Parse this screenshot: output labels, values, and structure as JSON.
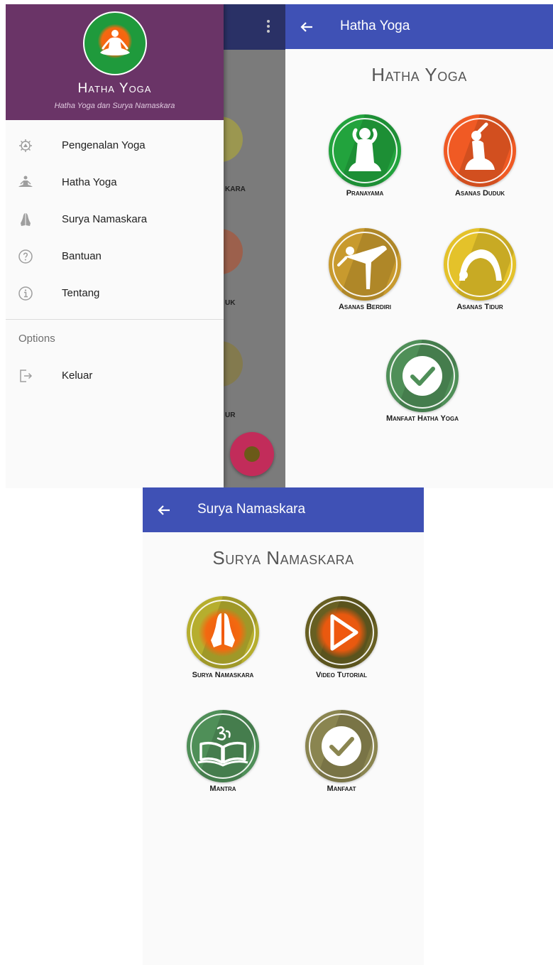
{
  "drawer_screen": {
    "background_labels": [
      "KARA",
      "UK",
      "UR"
    ],
    "header": {
      "title": "Hatha Yoga",
      "subtitle": "Hatha Yoga dan Surya Namaskara"
    },
    "menu": [
      {
        "label": "Pengenalan Yoga",
        "icon": "chakra-icon"
      },
      {
        "label": "Hatha Yoga",
        "icon": "meditation-pose-icon"
      },
      {
        "label": "Surya Namaskara",
        "icon": "praying-hands-icon"
      },
      {
        "label": "Bantuan",
        "icon": "help-icon"
      },
      {
        "label": "Tentang",
        "icon": "info-icon"
      }
    ],
    "section_label": "Options",
    "logout_label": "Keluar"
  },
  "hatha_screen": {
    "appbar_title": "Hatha Yoga",
    "heading": "Hatha Yoga",
    "tiles": [
      {
        "label": "Pranayama",
        "color": "#22a33d"
      },
      {
        "label": "Asanas Duduk",
        "color": "#f05a24"
      },
      {
        "label": "Asanas Berdiri",
        "color": "#c89a2e"
      },
      {
        "label": "Asanas Tidur",
        "color": "#e4c22a"
      },
      {
        "label": "Manfaat Hatha Yoga",
        "color": "#4f8f58"
      }
    ]
  },
  "surya_screen": {
    "appbar_title": "Surya Namaskara",
    "heading": "Surya Namaskara",
    "tiles": [
      {
        "label": "Surya Namaskara",
        "color": "#b6ae2e"
      },
      {
        "label": "Video Tutorial",
        "color": "#675f22"
      },
      {
        "label": "Mantra",
        "color": "#4f8f58"
      },
      {
        "label": "Manfaat",
        "color": "#8a8550"
      }
    ]
  },
  "colors": {
    "primary": "#3f51b5",
    "drawer_header": "#6a3467",
    "fab": "#c22c5a"
  }
}
